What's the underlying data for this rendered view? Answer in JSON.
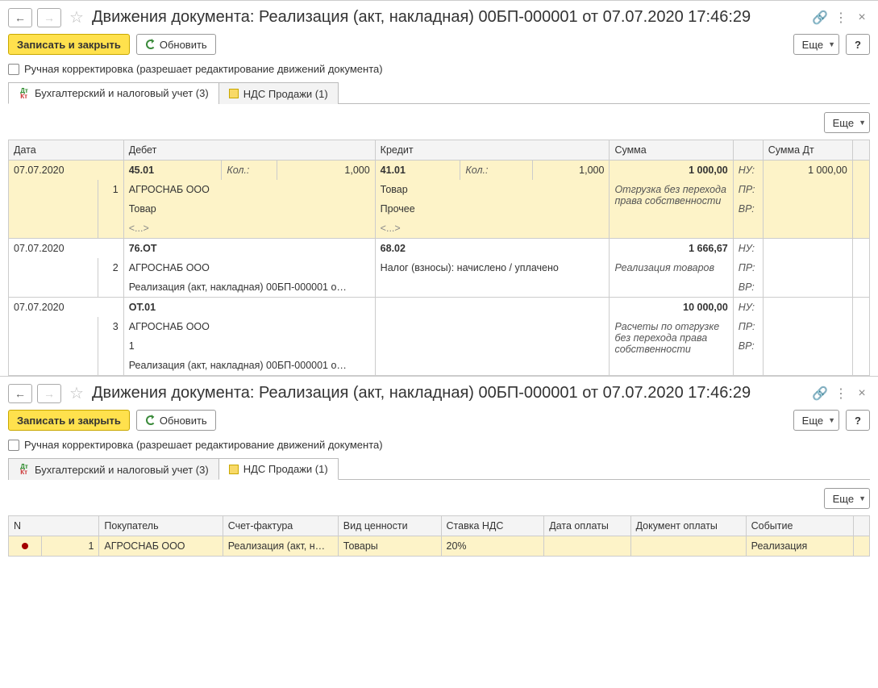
{
  "panes": [
    {
      "title": "Движения документа: Реализация (акт, накладная) 00БП-000001 от 07.07.2020 17:46:29",
      "toolbar": {
        "save_close": "Записать и закрыть",
        "refresh": "Обновить",
        "more": "Еще",
        "help": "?"
      },
      "manual_edit": {
        "label": "Ручная корректировка (разрешает редактирование движений документа)"
      },
      "tabs": {
        "accounting": "Бухгалтерский и налоговый учет (3)",
        "vat": "НДС Продажи (1)"
      },
      "active_tab": 0,
      "acct": {
        "headers": {
          "date": "Дата",
          "debit": "Дебет",
          "credit": "Кредит",
          "sum": "Сумма",
          "sum_dt": "Сумма Дт"
        },
        "qty_label": "Кол.:",
        "nu": "НУ:",
        "pr": "ПР:",
        "vr": "ВР:",
        "rows": [
          {
            "highlight": true,
            "date": "07.07.2020",
            "n": "1",
            "debit": {
              "acct": "45.01",
              "qty": "1,000",
              "l1": "АГРОСНАБ ООО",
              "l2": "Товар",
              "l3": "<...>"
            },
            "credit": {
              "acct": "41.01",
              "qty": "1,000",
              "l1": "Товар",
              "l2": "Прочее",
              "l3": "<...>"
            },
            "sum": "1 000,00",
            "sum_dt": "1 000,00",
            "note": "Отгрузка без перехода права собственности"
          },
          {
            "highlight": false,
            "date": "07.07.2020",
            "n": "2",
            "debit": {
              "acct": "76.ОТ",
              "l1": "АГРОСНАБ ООО",
              "l2": "Реализация (акт, накладная) 00БП-000001 о…"
            },
            "credit": {
              "acct": "68.02",
              "l1": "Налог (взносы): начислено / уплачено"
            },
            "sum": "1 666,67",
            "note": "Реализация товаров"
          },
          {
            "highlight": false,
            "date": "07.07.2020",
            "n": "3",
            "debit": {
              "acct": "ОТ.01",
              "l1": "АГРОСНАБ ООО",
              "l2": "1",
              "l3": "Реализация (акт, накладная) 00БП-000001 о…"
            },
            "credit": {},
            "sum": "10 000,00",
            "note": "Расчеты по отгрузке без перехода права собственности"
          }
        ]
      }
    },
    {
      "title": "Движения документа: Реализация (акт, накладная) 00БП-000001 от 07.07.2020 17:46:29",
      "toolbar": {
        "save_close": "Записать и закрыть",
        "refresh": "Обновить",
        "more": "Еще",
        "help": "?"
      },
      "manual_edit": {
        "label": "Ручная корректировка (разрешает редактирование движений документа)"
      },
      "tabs": {
        "accounting": "Бухгалтерский и налоговый учет (3)",
        "vat": "НДС Продажи (1)"
      },
      "active_tab": 1,
      "vat": {
        "headers": {
          "n": "N",
          "buyer": "Покупатель",
          "invoice": "Счет-фактура",
          "kind": "Вид ценности",
          "rate": "Ставка НДС",
          "pay_date": "Дата оплаты",
          "pay_doc": "Документ оплаты",
          "event": "Событие"
        },
        "row": {
          "n": "1",
          "buyer": "АГРОСНАБ ООО",
          "invoice": "Реализация (акт, н…",
          "kind": "Товары",
          "rate": "20%",
          "pay_date": "",
          "pay_doc": "",
          "event": "Реализация"
        }
      }
    }
  ]
}
